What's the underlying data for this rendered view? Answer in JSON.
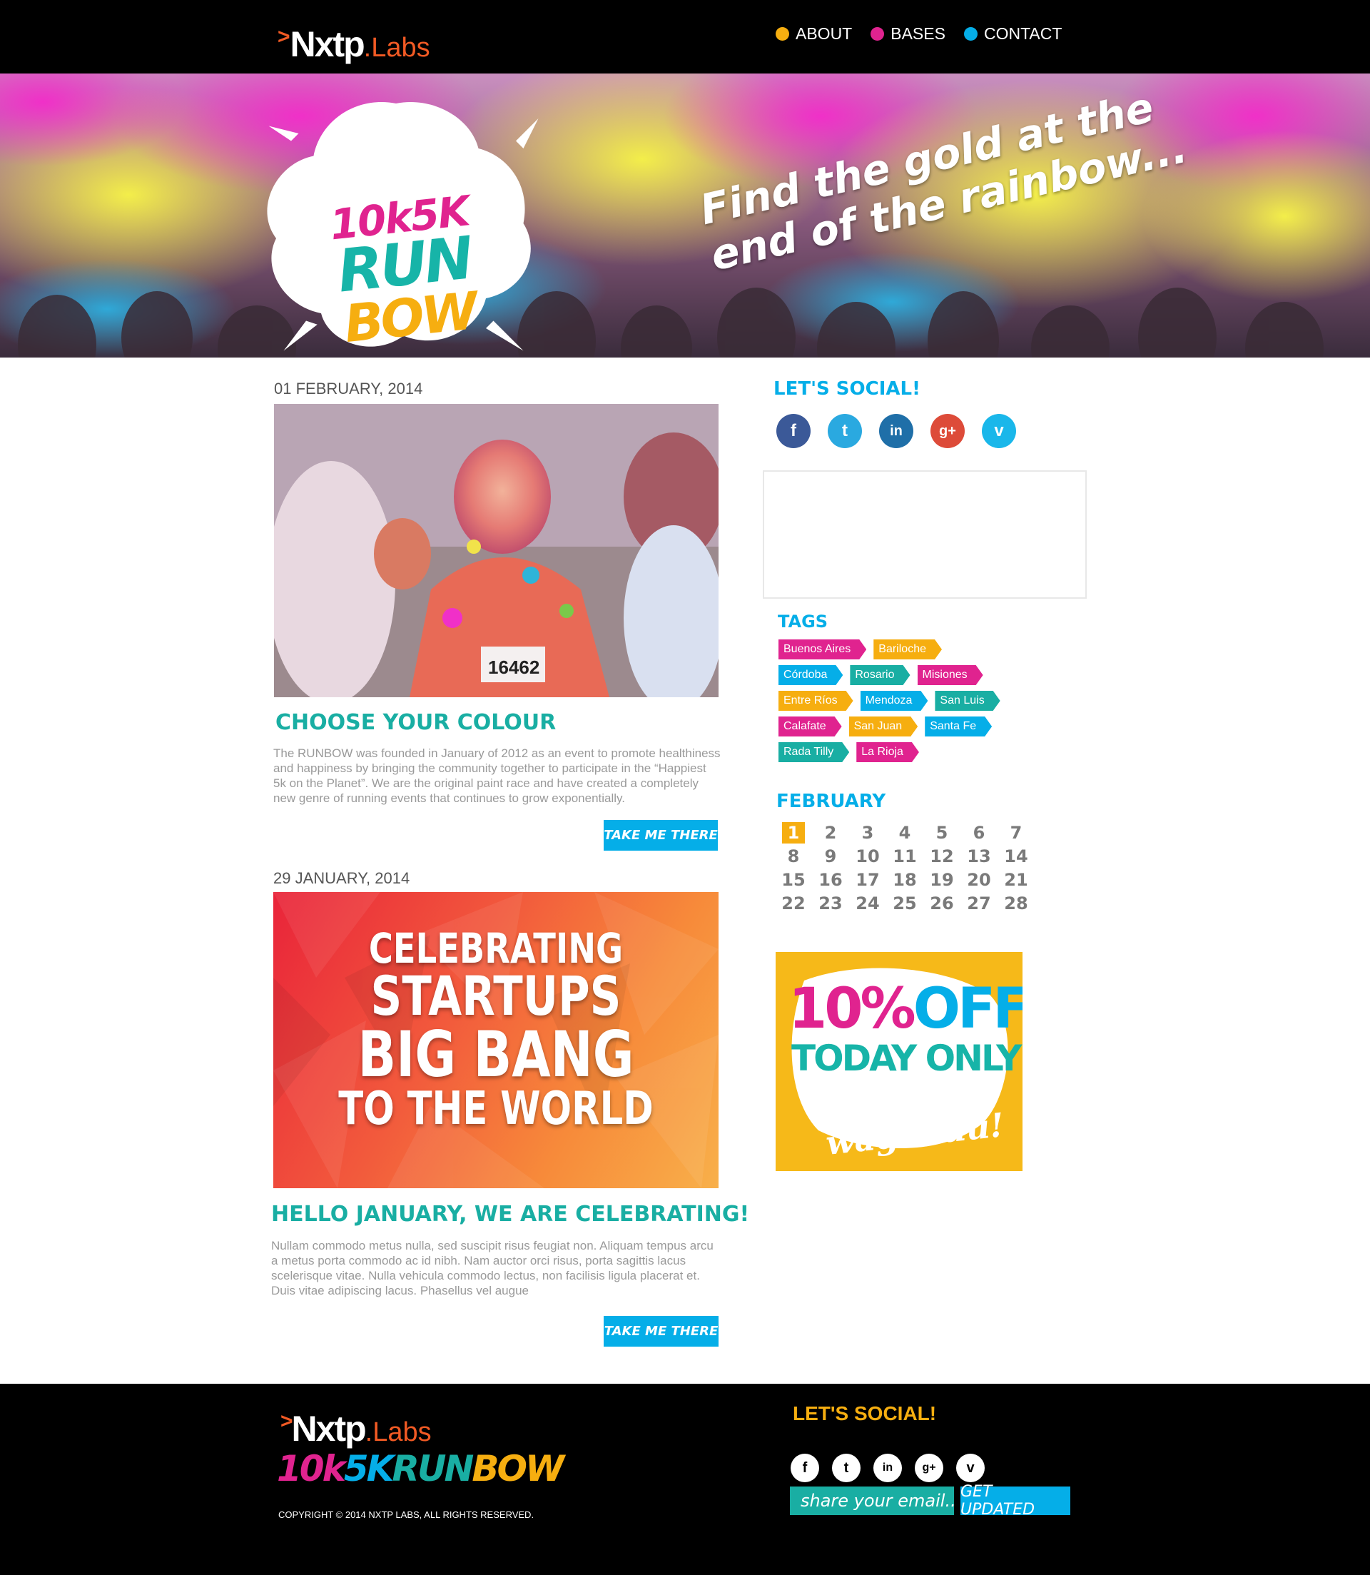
{
  "header": {
    "logo_main": "Nxtp",
    "logo_labs": ".Labs",
    "nav": [
      {
        "label": "ABOUT",
        "color": "#f6ae10"
      },
      {
        "label": "BASES",
        "color": "#e0238f"
      },
      {
        "label": "CONTACT",
        "color": "#05aee8"
      }
    ]
  },
  "hero": {
    "brand_line1": "10k5K",
    "brand_line2": "RUN",
    "brand_line3": "BOW",
    "tagline_line1": "Find the gold at the",
    "tagline_line2": "end of the rainbow..."
  },
  "posts": [
    {
      "date": "01 FEBRUARY, 2014",
      "title": "CHOOSE YOUR COLOUR",
      "body": "The RUNBOW was founded in January of 2012 as an event to promote healthiness and happiness by bringing the community together to participate in the “Happiest 5k on the Planet”. We are the original paint race and have created a completely new genre of running events that continues to grow exponentially.",
      "button": "TAKE ME THERE"
    },
    {
      "date": "29 JANUARY, 2014",
      "banner_line1": "CELEBRATING",
      "banner_line2": "STARTUPS",
      "banner_line3": "BIG BANG",
      "banner_line4": "TO THE WORLD",
      "title": "HELLO JANUARY, WE ARE CELEBRATING!",
      "body": "Nullam commodo metus nulla, sed suscipit risus feugiat non. Aliquam tempus arcu a metus porta commodo ac id nibh. Nam auctor orci risus, porta sagittis lacus scelerisque vitae. Nulla vehicula commodo lectus, non facilisis ligula placerat et. Duis vitae adipiscing lacus. Phasellus vel augue",
      "button": "TAKE ME THERE"
    }
  ],
  "sidebar": {
    "social_title": "LET'S SOCIAL!",
    "social": [
      {
        "icon": "facebook-icon",
        "glyph": "f",
        "color": "#3b5998"
      },
      {
        "icon": "twitter-icon",
        "glyph": "t",
        "color": "#2aa9e0"
      },
      {
        "icon": "linkedin-icon",
        "glyph": "in",
        "color": "#1f6fa8"
      },
      {
        "icon": "google-plus-icon",
        "glyph": "g+",
        "color": "#dd4b39"
      },
      {
        "icon": "vimeo-icon",
        "glyph": "v",
        "color": "#1ab7ea"
      }
    ],
    "tags_title": "TAGS",
    "tags": [
      [
        {
          "label": "Buenos Aires",
          "color": "#e0238f"
        },
        {
          "label": "Bariloche",
          "color": "#f6ae10"
        }
      ],
      [
        {
          "label": "Córdoba",
          "color": "#05aee8"
        },
        {
          "label": "Rosario",
          "color": "#19aea3"
        },
        {
          "label": "Misiones",
          "color": "#e0238f"
        }
      ],
      [
        {
          "label": "Entre Ríos",
          "color": "#f6ae10"
        },
        {
          "label": "Mendoza",
          "color": "#05aee8"
        },
        {
          "label": "San Luis",
          "color": "#19aea3"
        }
      ],
      [
        {
          "label": "Calafate",
          "color": "#e0238f"
        },
        {
          "label": "San Juan",
          "color": "#f6ae10"
        },
        {
          "label": "Santa Fe",
          "color": "#05aee8"
        }
      ],
      [
        {
          "label": "Rada Tilly",
          "color": "#19aea3"
        },
        {
          "label": "La Rioja",
          "color": "#e0238f"
        }
      ]
    ],
    "calendar_title": "FEBRUARY",
    "calendar_weeks": [
      [
        "1",
        "2",
        "3",
        "4",
        "5",
        "6",
        "7"
      ],
      [
        "8",
        "9",
        "10",
        "11",
        "12",
        "13",
        "14"
      ],
      [
        "15",
        "16",
        "17",
        "18",
        "19",
        "20",
        "21"
      ],
      [
        "22",
        "23",
        "24",
        "25",
        "26",
        "27",
        "28"
      ]
    ],
    "calendar_selected": "1",
    "ad": {
      "pct": "10%",
      "off": "OFF",
      "today": "TODAY ONLY",
      "brand": "wagaduu!"
    }
  },
  "footer": {
    "logo_main": "Nxtp",
    "logo_labs": ".Labs",
    "run_10k": "10k",
    "run_5k": "5K",
    "run_run": "RUN",
    "run_bow": "BOW",
    "copyright": "COPYRIGHT © 2014 NXTP LABS, ALL RIGHTS RESERVED.",
    "social_title": "LET'S SOCIAL!",
    "social": [
      {
        "icon": "facebook-icon",
        "glyph": "f"
      },
      {
        "icon": "twitter-icon",
        "glyph": "t"
      },
      {
        "icon": "linkedin-icon",
        "glyph": "in"
      },
      {
        "icon": "google-plus-icon",
        "glyph": "g+"
      },
      {
        "icon": "vimeo-icon",
        "glyph": "v"
      }
    ],
    "email_placeholder": "share your email...",
    "button": "GET UPDATED"
  },
  "colors": {
    "teal": "#19aea3",
    "blue": "#05aee8",
    "pink": "#e0238f",
    "yellow": "#f6ae10",
    "orange": "#f15a24"
  }
}
